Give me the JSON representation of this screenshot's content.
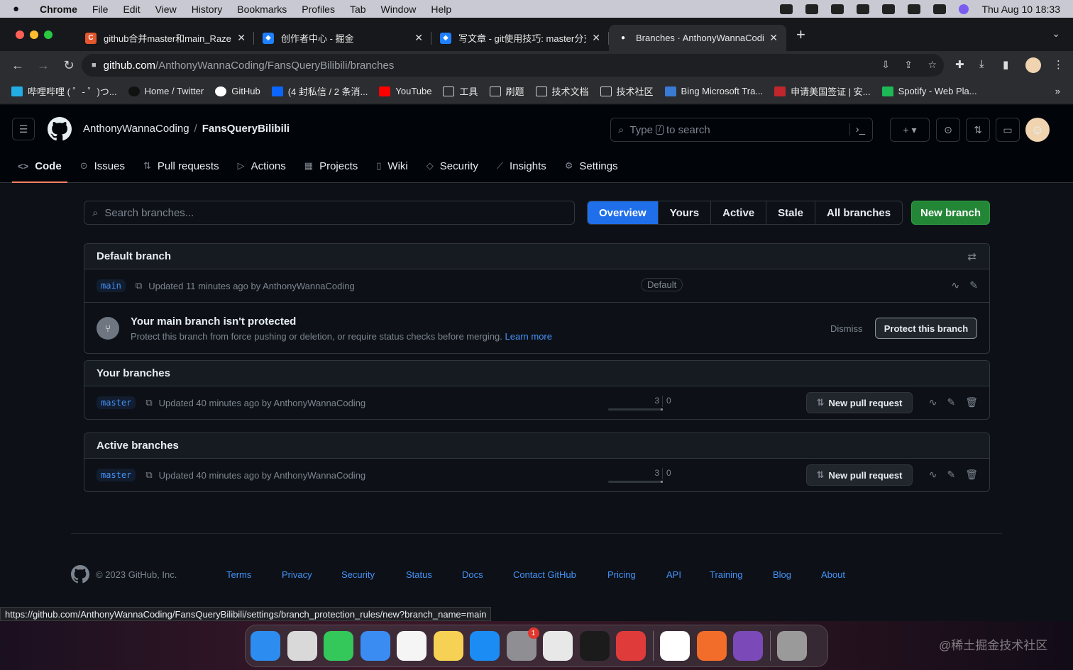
{
  "menubar": {
    "items": [
      "Chrome",
      "File",
      "Edit",
      "View",
      "History",
      "Bookmarks",
      "Profiles",
      "Tab",
      "Window",
      "Help"
    ],
    "clock": "Thu Aug 10  18:33"
  },
  "tabs": [
    {
      "title": "github合并master和main_Raze",
      "favicon_color": "#e4572e",
      "favicon_glyph": "C"
    },
    {
      "title": "创作者中心 - 掘金",
      "favicon_color": "#1e80ff",
      "favicon_glyph": "◆"
    },
    {
      "title": "写文章 - git使用技巧: master分支",
      "favicon_color": "#1e80ff",
      "favicon_glyph": "◆"
    },
    {
      "title": "Branches · AnthonyWannaCodin",
      "favicon_color": "#ffffff",
      "favicon_glyph": "●",
      "active": true
    }
  ],
  "address": {
    "host": "github.com",
    "path": "/AnthonyWannaCoding/FansQueryBilibili/branches"
  },
  "bookmarks": [
    {
      "label": "哔哩哔哩 ( ゜- ゜)つ...",
      "color": "#23ade5"
    },
    {
      "label": "Home / Twitter",
      "color": "#111111"
    },
    {
      "label": "GitHub",
      "color": "#ffffff"
    },
    {
      "label": "(4 封私信 / 2 条消...",
      "color": "#0a66ff"
    },
    {
      "label": "YouTube",
      "color": "#ff0000"
    },
    {
      "label": "工具",
      "color": "folder"
    },
    {
      "label": "刷题",
      "color": "folder"
    },
    {
      "label": "技术文档",
      "color": "folder"
    },
    {
      "label": "技术社区",
      "color": "folder"
    },
    {
      "label": "Bing Microsoft Tra...",
      "color": "#3a7bd5"
    },
    {
      "label": "申请美国签证 | 安...",
      "color": "#c0262c"
    },
    {
      "label": "Spotify - Web Pla...",
      "color": "#1db954"
    }
  ],
  "bookmarks_more": "»",
  "repo": {
    "owner": "AnthonyWannaCoding",
    "separator": "/",
    "name": "FansQueryBilibili"
  },
  "search": {
    "prefix": "Type",
    "key": "/",
    "suffix": "to search"
  },
  "repo_nav": [
    {
      "label": "Code",
      "icon": "code-icon",
      "glyph": "<>",
      "active": true
    },
    {
      "label": "Issues",
      "icon": "issue-icon",
      "glyph": "⊙"
    },
    {
      "label": "Pull requests",
      "icon": "pull-request-icon",
      "glyph": "⇅"
    },
    {
      "label": "Actions",
      "icon": "play-icon",
      "glyph": "▷"
    },
    {
      "label": "Projects",
      "icon": "table-icon",
      "glyph": "▦"
    },
    {
      "label": "Wiki",
      "icon": "book-icon",
      "glyph": "▯"
    },
    {
      "label": "Security",
      "icon": "shield-icon",
      "glyph": "◇"
    },
    {
      "label": "Insights",
      "icon": "graph-icon",
      "glyph": "⟋"
    },
    {
      "label": "Settings",
      "icon": "gear-icon",
      "glyph": "⚙"
    }
  ],
  "branches": {
    "search_placeholder": "Search branches...",
    "filters": [
      "Overview",
      "Yours",
      "Active",
      "Stale",
      "All branches"
    ],
    "active_filter": "Overview",
    "new_branch": "New branch",
    "default_section": {
      "title": "Default branch",
      "branch": "main",
      "updated": "Updated 11 minutes ago by AnthonyWannaCoding",
      "badge": "Default"
    },
    "protection": {
      "title": "Your main branch isn't protected",
      "description": "Protect this branch from force pushing or deletion, or require status checks before merging.",
      "learn_more": "Learn more",
      "dismiss": "Dismiss",
      "protect": "Protect this branch"
    },
    "your_section": {
      "title": "Your branches",
      "branch": "master",
      "updated": "Updated 40 minutes ago by AnthonyWannaCoding",
      "behind": "3",
      "ahead": "0",
      "pr_button": "New pull request"
    },
    "active_section": {
      "title": "Active branches",
      "branch": "master",
      "updated": "Updated 40 minutes ago by AnthonyWannaCoding",
      "behind": "3",
      "ahead": "0",
      "pr_button": "New pull request"
    }
  },
  "footer": {
    "copyright": "© 2023 GitHub, Inc.",
    "links": [
      "Terms",
      "Privacy",
      "Security",
      "Status",
      "Docs",
      "Contact GitHub",
      "Pricing",
      "API",
      "Training",
      "Blog",
      "About"
    ]
  },
  "status_url": "https://github.com/AnthonyWannaCoding/FansQueryBilibili/settings/branch_protection_rules/new?branch_name=main",
  "dock": [
    {
      "name": "finder-icon",
      "color": "#2d8cf0"
    },
    {
      "name": "launchpad-icon",
      "color": "#d9d9d9"
    },
    {
      "name": "messages-icon",
      "color": "#34c759"
    },
    {
      "name": "mail-icon",
      "color": "#3b8cf2"
    },
    {
      "name": "photos-icon",
      "color": "#f5f5f5"
    },
    {
      "name": "notes-icon",
      "color": "#f7d154"
    },
    {
      "name": "app-store-icon",
      "color": "#1c8cf5"
    },
    {
      "name": "system-settings-icon",
      "color": "#8e8e93"
    },
    {
      "name": "chrome-icon",
      "color": "#e8e8e8"
    },
    {
      "name": "terminal-icon",
      "color": "#1b1b1b"
    },
    {
      "name": "netease-music-icon",
      "color": "#e03b3b"
    },
    {
      "name": "qq-icon",
      "color": "#ffffff"
    },
    {
      "name": "intellij-icon",
      "color": "#f26d2a"
    },
    {
      "name": "github-desktop-icon",
      "color": "#7b4ab8"
    },
    {
      "name": "trash-icon",
      "color": "#9a9a9a"
    }
  ],
  "dock_badge": "1",
  "watermark": "@稀土掘金技术社区"
}
